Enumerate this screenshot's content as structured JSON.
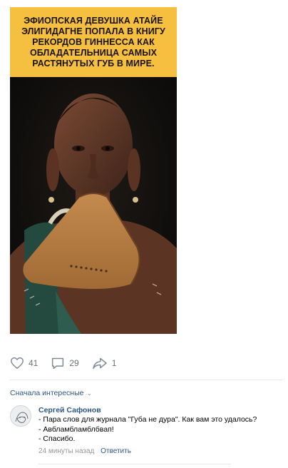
{
  "post": {
    "caption_lines": [
      "ЭФИОПСКАЯ ДЕВУШКА АТАЙЕ",
      "ЭЛИГИДАГНЕ ПОПАЛА В КНИГУ",
      "РЕКОРДОВ ГИННЕССА КАК",
      "ОБЛАДАТЕЛЬНИЦА САМЫХ",
      "РАСТЯНУТЫХ ГУБ В МИРЕ."
    ],
    "caption_bg": "#f5c040"
  },
  "actions": {
    "likes": "41",
    "comments": "29",
    "shares": "1"
  },
  "comments_sort": {
    "label": "Сначала интересные"
  },
  "comment": {
    "author": "Сергей Сафонов",
    "lines": [
      "- Пара слов для журнала \"Губа не дура\". Как вам это удалось?",
      "- Авбламбламблбвап!",
      "- Спасибо."
    ],
    "time": "24 минуты назад",
    "reply_label": "Ответить"
  },
  "colors": {
    "link": "#2a5885",
    "muted": "#939699",
    "icon": "#7f8a96"
  }
}
